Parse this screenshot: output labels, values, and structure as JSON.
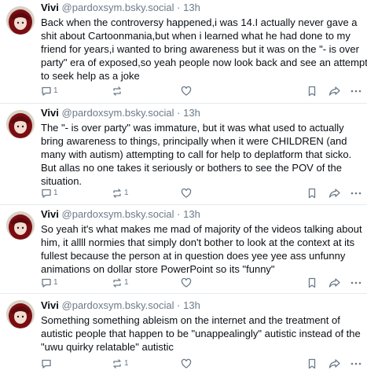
{
  "posts": [
    {
      "author": "Vivi",
      "handle": "@pardoxsym.bsky.social",
      "separator": "·",
      "time": "13h",
      "lines": [
        "Back when the controversy happened,i was 14.I actually never gave a",
        "shit about Cartoonmania,but when i learned what he had done to my",
        "friend for years,i wanted to bring awareness but it was on the \"- is over",
        "party\" era of exposed,so yeah people now look back and see an attempt",
        "to seek help as a joke"
      ],
      "reply_count": "1",
      "repost_count": "",
      "like_count": ""
    },
    {
      "author": "Vivi",
      "handle": "@pardoxsym.bsky.social",
      "separator": "·",
      "time": "13h",
      "lines": [
        "The \"- is over party\" was immature, but it was what used to actually",
        "bring awareness to things, principally when it were CHILDREN (and",
        "many with autism) attempting to call for help to deplatform that sicko.",
        "But allas no one takes it seriously or bothers to see the POV of the",
        "situation."
      ],
      "reply_count": "1",
      "repost_count": "1",
      "like_count": ""
    },
    {
      "author": "Vivi",
      "handle": "@pardoxsym.bsky.social",
      "separator": "·",
      "time": "13h",
      "lines": [
        "So yeah it's what makes me mad of majority of the videos talking about",
        "him, it allll normies that simply don't bother to look at the context at its",
        "fullest because the person at in question does yee yee ass unfunny",
        "animations on dollar store PowerPoint so its \"funny\""
      ],
      "reply_count": "1",
      "repost_count": "1",
      "like_count": ""
    },
    {
      "author": "Vivi",
      "handle": "@pardoxsym.bsky.social",
      "separator": "·",
      "time": "13h",
      "lines": [
        "Something something ableism on the internet and the treatment of",
        "autistic people that happen to be \"unappealingly\" autistic instead of the",
        "\"uwu quirky relatable\" autistic"
      ],
      "reply_count": "",
      "repost_count": "1",
      "like_count": ""
    }
  ],
  "icons": {
    "reply": "speech-bubble-icon",
    "repost": "repost-arrows-icon",
    "like": "heart-icon",
    "bookmark": "bookmark-icon",
    "share": "share-arrow-icon",
    "more": "more-dots-icon"
  },
  "colors": {
    "text": "#0b0f14",
    "muted": "#6c7a89",
    "divider": "#e6eaee",
    "avatar_hair": "#7a0d12",
    "avatar_bg": "#d9d2c6"
  }
}
